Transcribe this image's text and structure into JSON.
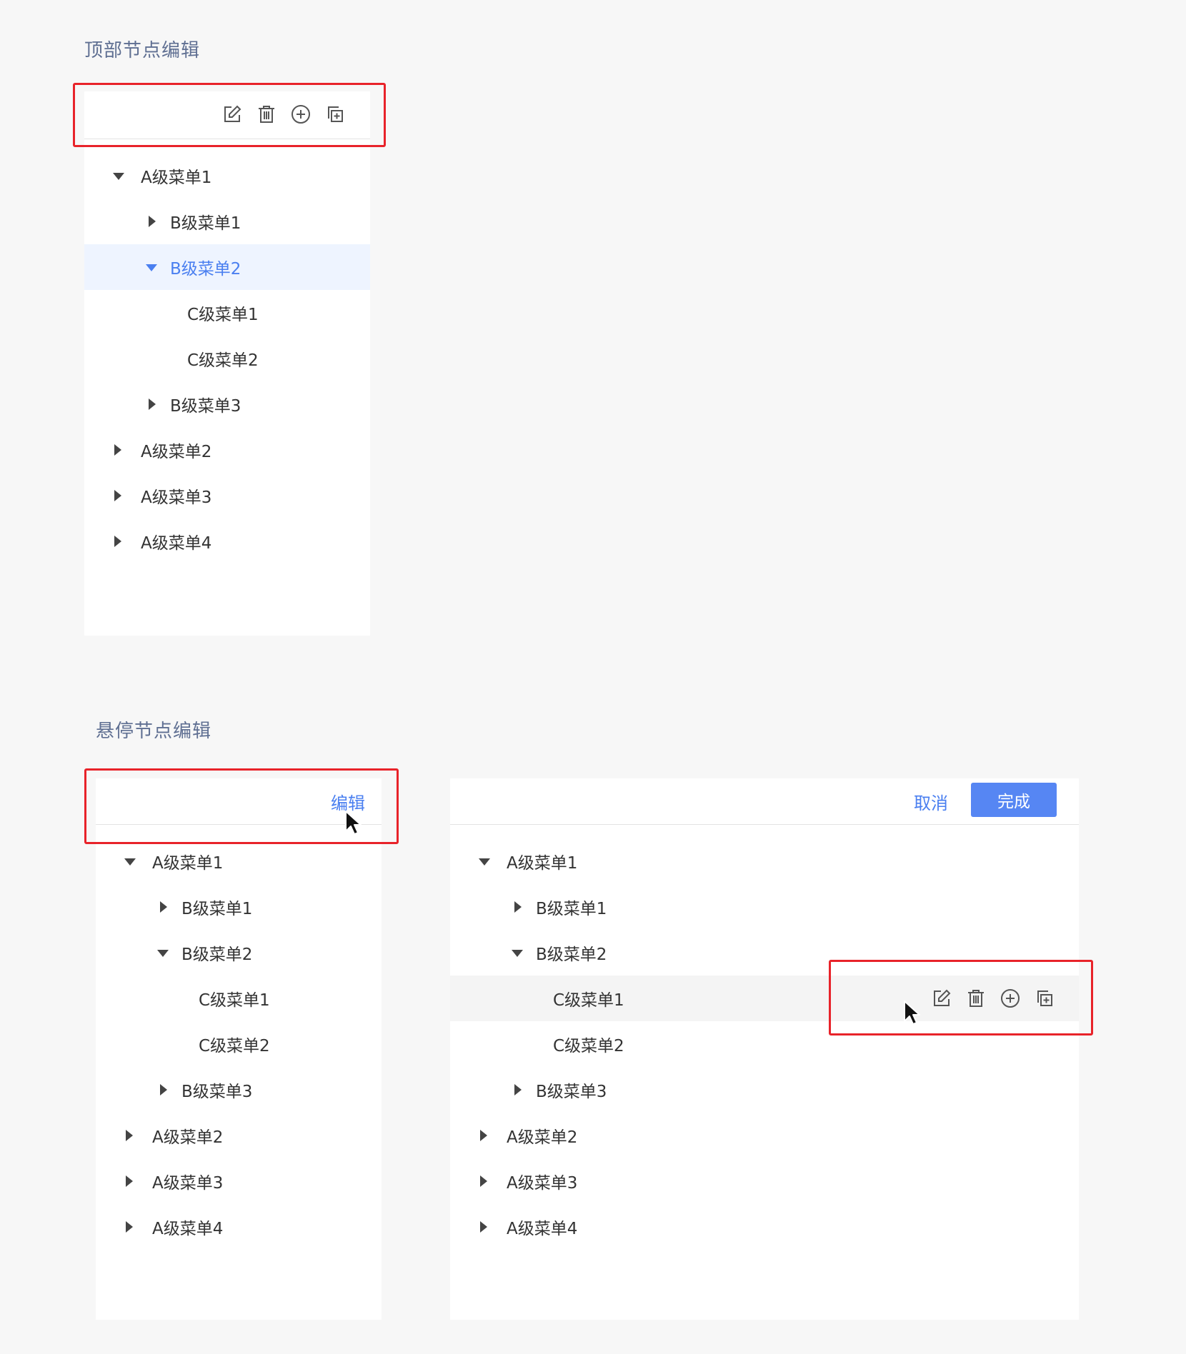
{
  "top_section": {
    "title": "顶部节点编辑",
    "tree": [
      {
        "label": "A级菜单1",
        "caret": "down"
      },
      {
        "label": "B级菜单1",
        "caret": "right"
      },
      {
        "label": "B级菜单2",
        "caret": "down",
        "selected": true
      },
      {
        "label": "C级菜单1",
        "caret": "none"
      },
      {
        "label": "C级菜单2",
        "caret": "none"
      },
      {
        "label": "B级菜单3",
        "caret": "right"
      },
      {
        "label": "A级菜单2",
        "caret": "right"
      },
      {
        "label": "A级菜单3",
        "caret": "right"
      },
      {
        "label": "A级菜单4",
        "caret": "right"
      }
    ],
    "toolbar_icons": [
      "edit-icon",
      "delete-icon",
      "add-circle-icon",
      "add-child-icon"
    ]
  },
  "hover_section": {
    "title": "悬停节点编辑",
    "left_panel": {
      "edit_link": "编辑",
      "tree": [
        {
          "label": "A级菜单1",
          "caret": "down"
        },
        {
          "label": "B级菜单1",
          "caret": "right"
        },
        {
          "label": "B级菜单2",
          "caret": "down"
        },
        {
          "label": "C级菜单1",
          "caret": "none"
        },
        {
          "label": "C级菜单2",
          "caret": "none"
        },
        {
          "label": "B级菜单3",
          "caret": "right"
        },
        {
          "label": "A级菜单2",
          "caret": "right"
        },
        {
          "label": "A级菜单3",
          "caret": "right"
        },
        {
          "label": "A级菜单4",
          "caret": "right"
        }
      ]
    },
    "right_panel": {
      "cancel_label": "取消",
      "done_label": "完成",
      "tree": [
        {
          "label": "A级菜单1",
          "caret": "down"
        },
        {
          "label": "B级菜单1",
          "caret": "right"
        },
        {
          "label": "B级菜单2",
          "caret": "down"
        },
        {
          "label": "C级菜单1",
          "caret": "none",
          "hovered": true
        },
        {
          "label": "C级菜单2",
          "caret": "none"
        },
        {
          "label": "B级菜单3",
          "caret": "right"
        },
        {
          "label": "A级菜单2",
          "caret": "right"
        },
        {
          "label": "A级菜单3",
          "caret": "right"
        },
        {
          "label": "A级菜单4",
          "caret": "right"
        }
      ],
      "row_icons": [
        "edit-icon",
        "delete-icon",
        "add-circle-icon",
        "add-child-icon"
      ]
    }
  },
  "colors": {
    "accent": "#4a7ff0",
    "primary_button": "#5686f3",
    "highlight_box": "#e8232a",
    "selected_row_bg": "#eef4ff",
    "hover_row_bg": "#f4f4f4"
  }
}
